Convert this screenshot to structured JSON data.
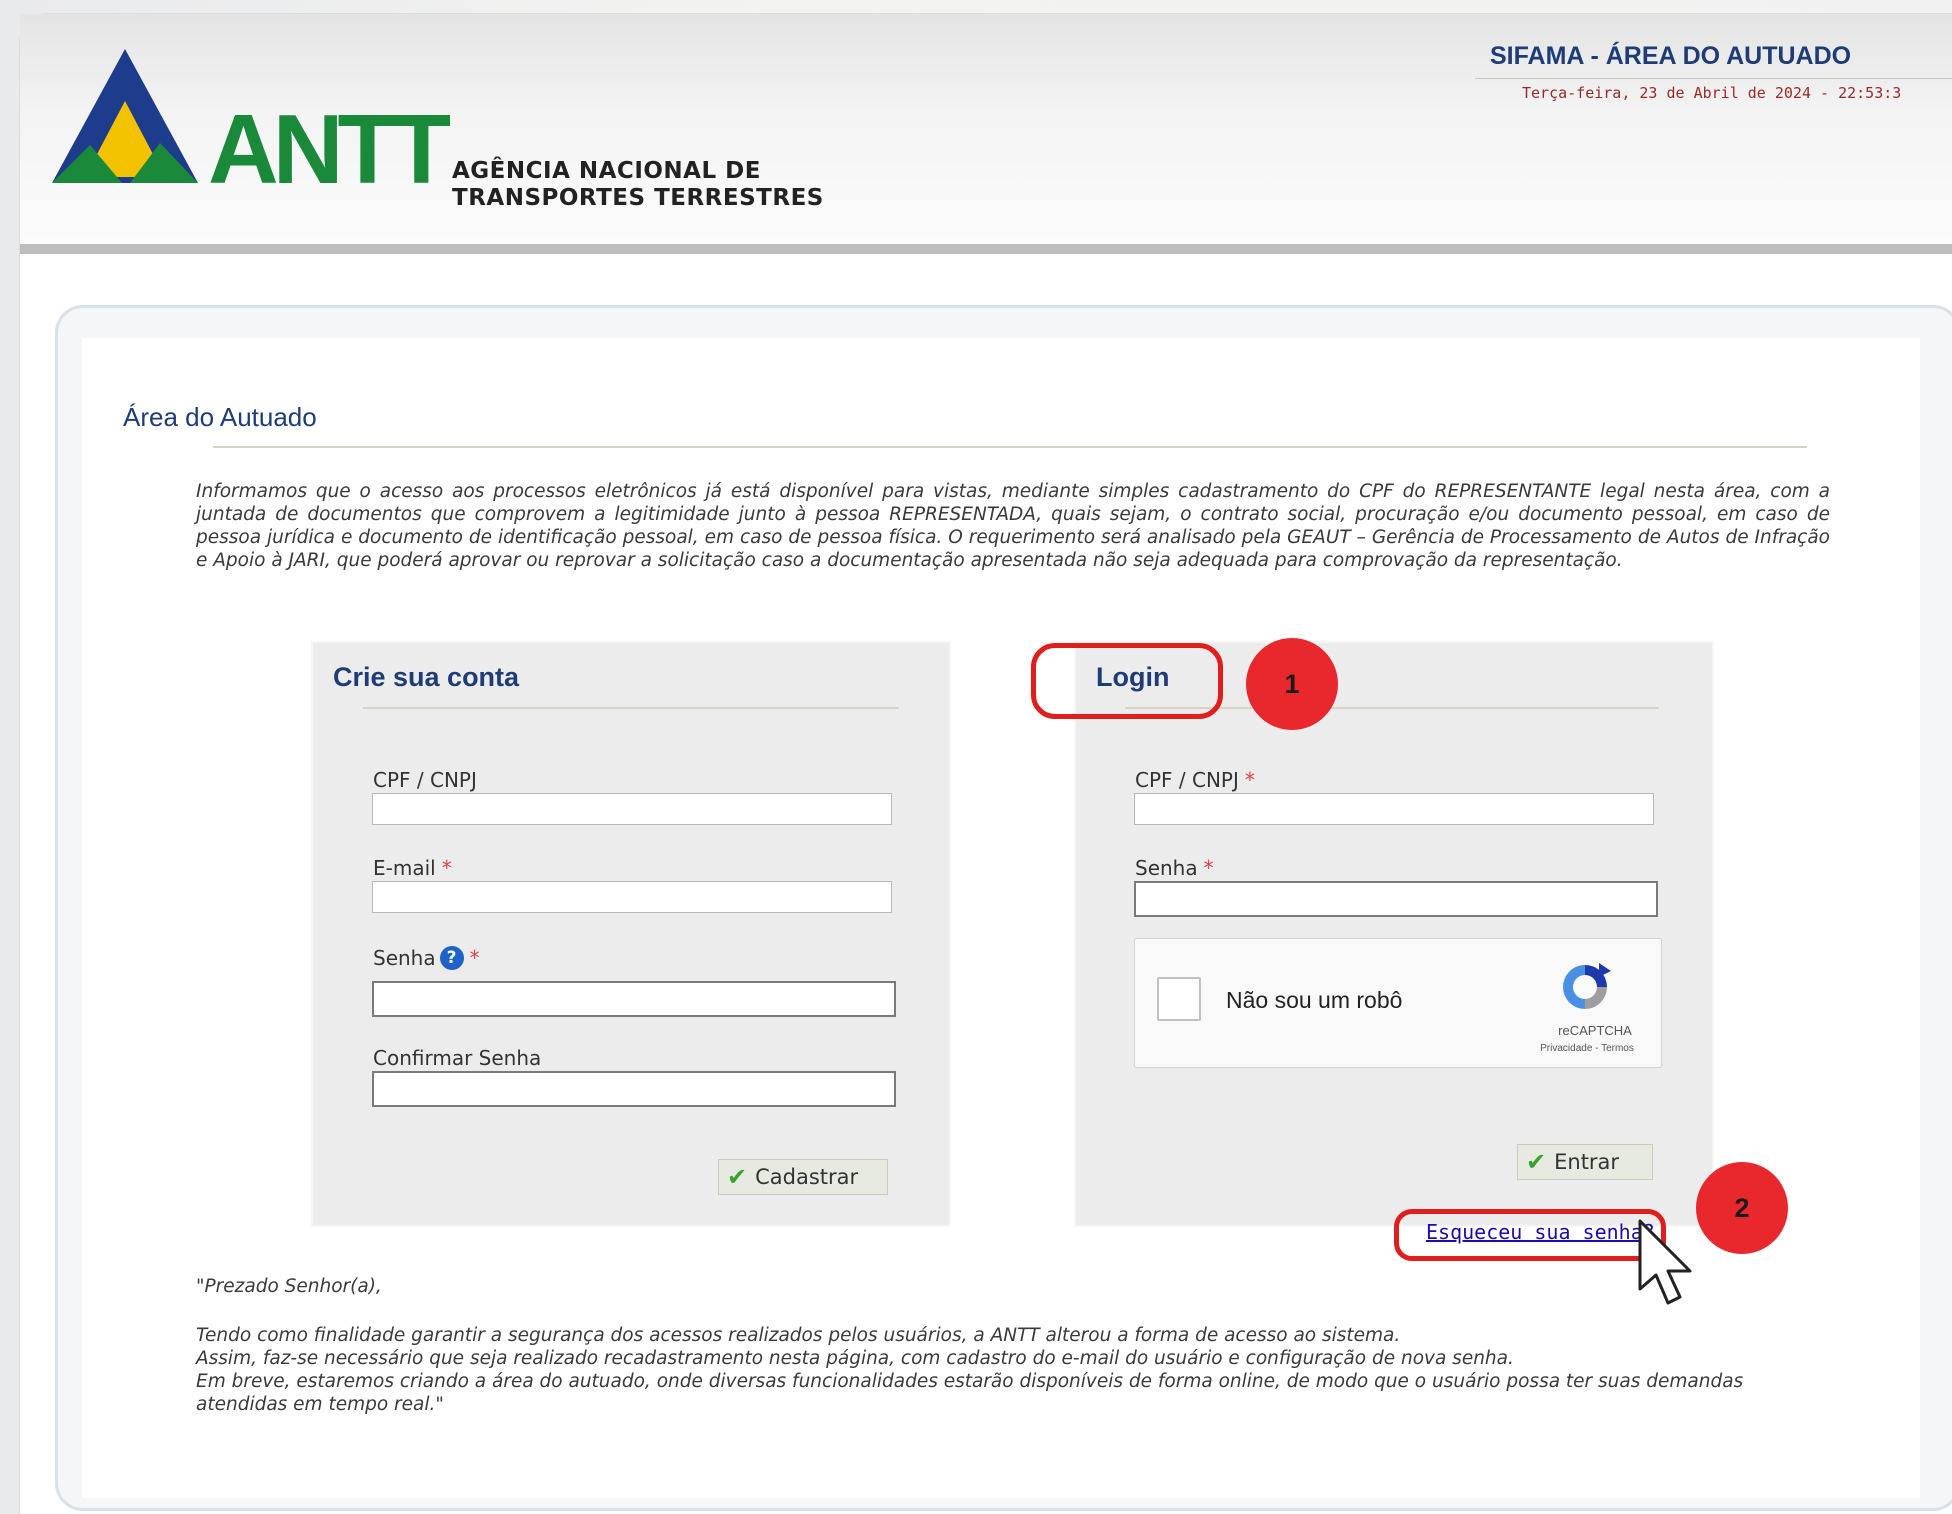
{
  "header": {
    "logo_text": "ANTT",
    "org_name_line1": "AGÊNCIA NACIONAL DE",
    "org_name_line2": "TRANSPORTES TERRESTRES",
    "system_title": "SIFAMA - ÁREA DO AUTUADO",
    "datetime": "Terça-feira, 23 de Abril de 2024 - 22:53:3"
  },
  "page": {
    "title": "Área do Autuado",
    "intro": "Informamos que o acesso aos processos eletrônicos já está disponível para vistas, mediante simples cadastramento do CPF do REPRESENTANTE legal nesta área, com a juntada de documentos que comprovem a legitimidade junto à pessoa REPRESENTADA, quais sejam, o contrato social, procuração e/ou documento pessoal, em caso de pessoa jurídica e documento de identificação pessoal, em caso de pessoa física. O requerimento será analisado pela GEAUT – Gerência de Processamento de Autos de Infração e Apoio à JARI, que poderá aprovar ou reprovar a solicitação caso a documentação apresentada não seja adequada para comprovação da representação."
  },
  "register": {
    "title": "Crie sua conta",
    "cpf_label": "CPF / CNPJ",
    "email_label": "E-mail",
    "password_label": "Senha",
    "confirm_label": "Confirmar Senha",
    "required_mark": "*",
    "help_symbol": "?",
    "submit_label": "Cadastrar"
  },
  "login": {
    "title": "Login",
    "cpf_label": "CPF / CNPJ",
    "password_label": "Senha",
    "required_mark": "*",
    "captcha_label": "Não sou um robô",
    "captcha_brand": "reCAPTCHA",
    "captcha_links": "Privacidade - Termos",
    "submit_label": "Entrar",
    "forgot_link": "Esqueceu sua senha?"
  },
  "notice": {
    "line1": "\"Prezado Senhor(a),",
    "line2": "Tendo como finalidade garantir a segurança dos acessos realizados pelos usuários, a ANTT alterou a forma de acesso ao sistema.",
    "line3": "Assim, faz-se necessário que seja realizado recadastramento nesta página, com cadastro do e-mail do usuário e configuração de nova senha.",
    "line4": "Em breve, estaremos criando a área do autuado, onde diversas funcionalidades estarão disponíveis de forma online, de modo que o usuário possa ter suas demandas atendidas em tempo real.\""
  },
  "annotations": {
    "step1": "1",
    "step2": "2",
    "color": "#e8282d"
  },
  "colors": {
    "title_blue": "#1e3c78",
    "logo_green": "#1a8a3a",
    "logo_blue": "#1e3c8c",
    "logo_yellow": "#f2c200"
  },
  "icons": {
    "help": "question-circle-icon",
    "check": "checkmark-icon",
    "recaptcha": "recaptcha-logo-icon",
    "cursor": "mouse-pointer-icon"
  }
}
